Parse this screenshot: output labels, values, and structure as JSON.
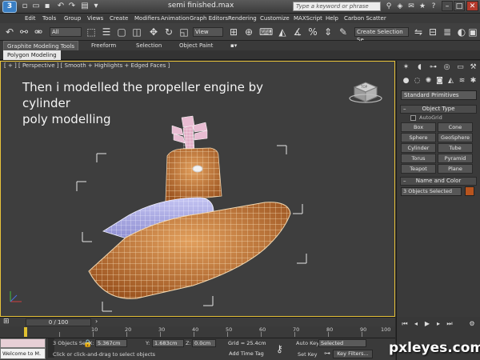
{
  "window": {
    "title": "semi finished.max",
    "app_logo": "3",
    "search_placeholder": "Type a keyword or phrase"
  },
  "menu": [
    "Edit",
    "Tools",
    "Group",
    "Views",
    "Create",
    "Modifiers",
    "Animation",
    "Graph Editors",
    "Rendering",
    "Customize",
    "MAXScript",
    "Help",
    "Carbon Scatter"
  ],
  "main_toolbar": {
    "selection_filter": "All",
    "reference_coord": "View",
    "named_selection": "Create Selection Se"
  },
  "ribbon": {
    "tabs": [
      "Graphite Modeling Tools",
      "Freeform",
      "Selection",
      "Object Paint"
    ],
    "active_subtab": "Polygon Modeling"
  },
  "viewport": {
    "label": "[ + ] [ Perspective ] [ Smooth + Highlights + Edged Faces ]",
    "annotation_line1": "Then i modelled the propeller engine by cylinder",
    "annotation_line2": "poly modelling",
    "viewcube_face": "TOP"
  },
  "command_panel": {
    "primitive_type": "Standard Primitives",
    "object_type_title": "Object Type",
    "autogrid_label": "AutoGrid",
    "buttons": [
      "Box",
      "Cone",
      "Sphere",
      "GeoSphere",
      "Cylinder",
      "Tube",
      "Torus",
      "Pyramid",
      "Teapot",
      "Plane"
    ],
    "name_color_title": "Name and Color",
    "name_value": "3 Objects Selected",
    "object_color": "#b8541e"
  },
  "timeline": {
    "frame_display": "0 / 100",
    "ticks": [
      "10",
      "20",
      "30",
      "40",
      "50",
      "60",
      "70",
      "80",
      "90",
      "100"
    ]
  },
  "status": {
    "listener_text": "Welcome to M.",
    "selection_info": "3 Objects Sele",
    "prompt": "Click or click-and-drag to select objects",
    "x_label": "X:",
    "x_value": "5.367cm",
    "y_label": "Y:",
    "y_value": "1.683cm",
    "z_label": "Z:",
    "z_value": "0.0cm",
    "grid": "Grid = 25.4cm",
    "add_time_tag": "Add Time Tag",
    "auto_key": "Auto Key",
    "key_mode": "Selected",
    "set_key": "Set Key",
    "key_filters": "Key Filters..."
  },
  "watermark": "pxleyes.com"
}
